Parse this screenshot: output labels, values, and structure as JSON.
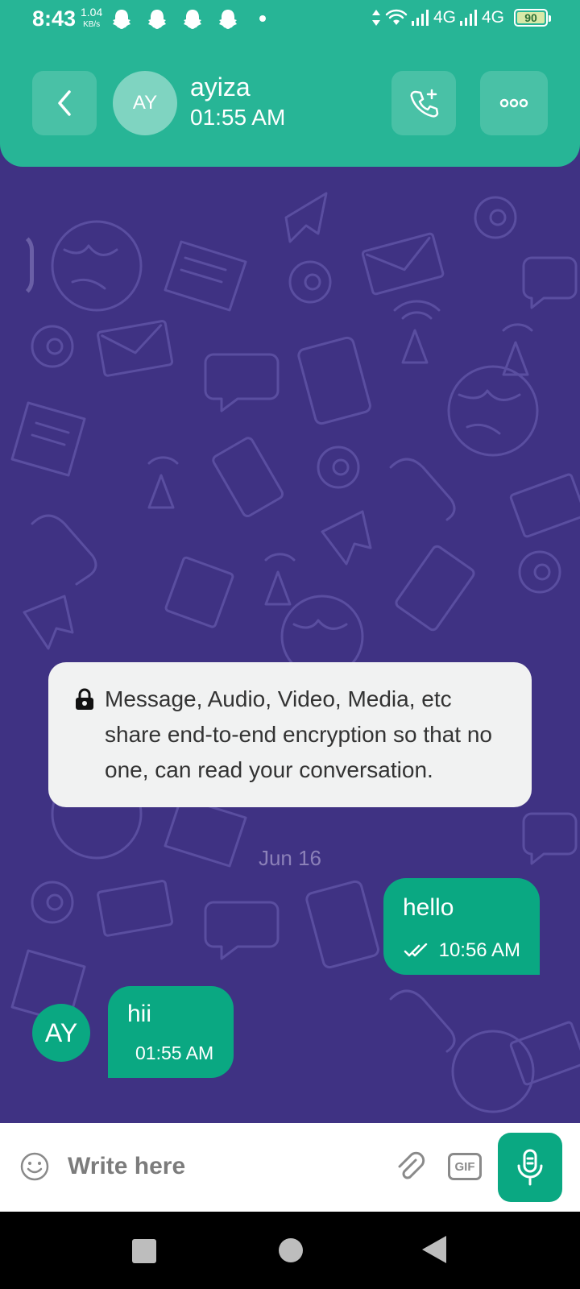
{
  "status_bar": {
    "time": "8:43",
    "net_speed": "1.04",
    "net_speed_unit": "KB/s",
    "network_1": "4G",
    "network_2": "4G",
    "battery": "90"
  },
  "header": {
    "avatar_initials": "AY",
    "contact_name": "ayiza",
    "contact_status": "01:55 AM"
  },
  "chat": {
    "encryption_notice": "Message, Audio, Video, Media, etc share end-to-end encryption so that no one, can read your conversation.",
    "date_separator": "Jun 16",
    "messages": [
      {
        "direction": "outgoing",
        "text": "hello",
        "time": "10:56 AM",
        "status": "read"
      },
      {
        "direction": "incoming",
        "sender_initials": "AY",
        "text": "hii",
        "time": "01:55 AM"
      }
    ]
  },
  "composer": {
    "placeholder": "Write here",
    "gif_label": "GIF"
  },
  "icons": {
    "back": "chevron-left-icon",
    "call": "add-call-icon",
    "more": "more-horizontal-icon",
    "lock": "lock-icon",
    "read_receipt": "double-check-icon",
    "emoji": "emoji-icon",
    "attach": "paperclip-icon",
    "mic": "microphone-icon"
  },
  "colors": {
    "header": "#27b596",
    "wallpaper": "#3f3283",
    "bubble": "#0aa882",
    "notice_bg": "#f1f2f2"
  }
}
